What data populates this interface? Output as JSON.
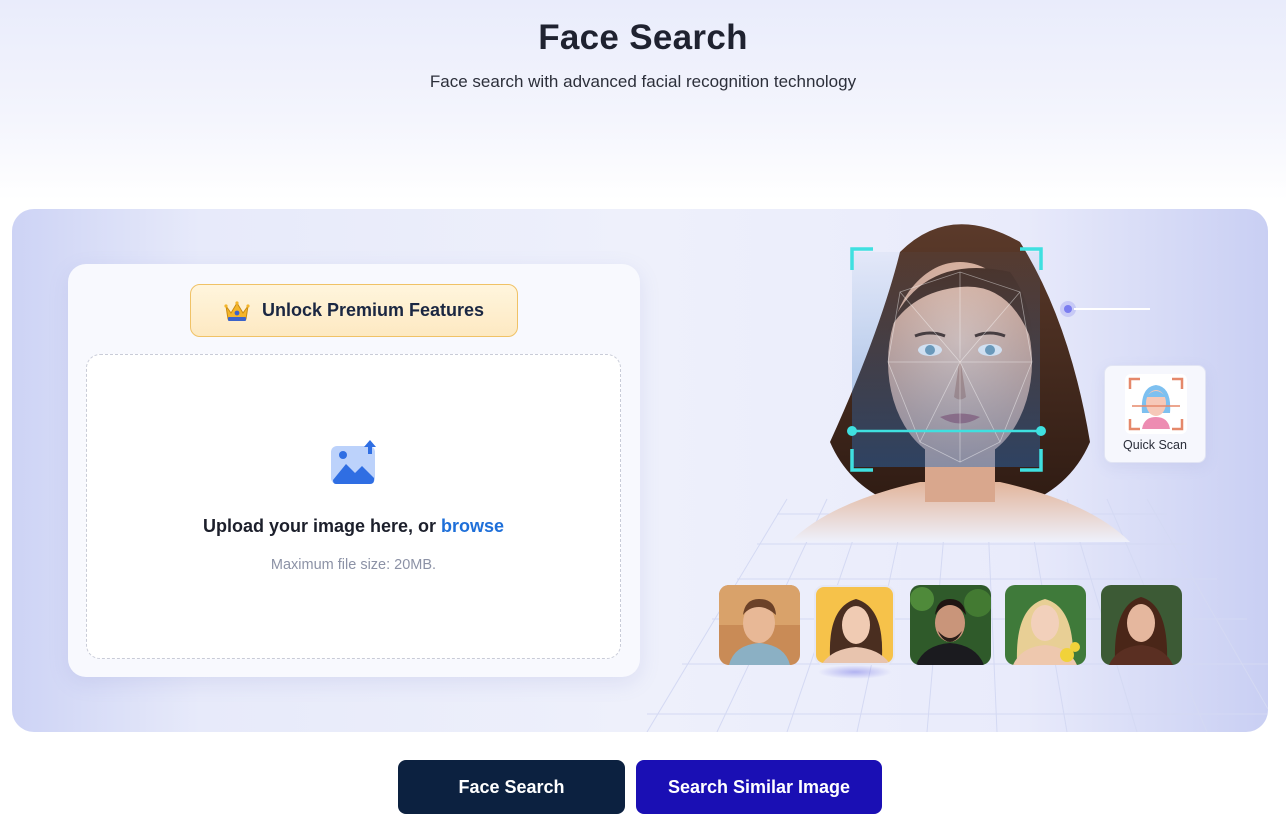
{
  "header": {
    "title": "Face Search",
    "subtitle": "Face search with advanced facial recognition technology"
  },
  "upload": {
    "premium_label": "Unlock Premium Features",
    "prompt_text": "Upload your image here, or ",
    "browse_label": "browse",
    "hint": "Maximum file size: 20MB."
  },
  "preview": {
    "quick_scan_label": "Quick Scan",
    "thumbnails": [
      "face-thumb-1",
      "face-thumb-2",
      "face-thumb-3",
      "face-thumb-4",
      "face-thumb-5"
    ]
  },
  "actions": {
    "face_search_label": "Face Search",
    "similar_label": "Search Similar Image"
  },
  "colors": {
    "primary_dark": "#0c2140",
    "primary_blue": "#1a0fb4",
    "link_blue": "#1e6fd9",
    "scan_cyan": "#3fe0e0",
    "premium_border": "#f0c266"
  },
  "icons": {
    "premium": "crown-icon",
    "upload": "image-upload-icon",
    "scan": "face-scan-icon"
  }
}
